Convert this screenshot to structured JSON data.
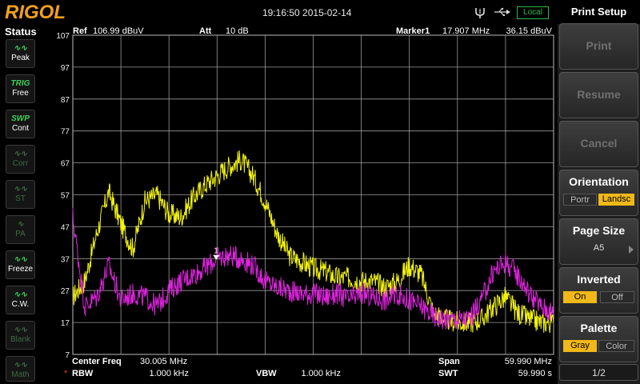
{
  "brand": "RIGOL",
  "datetime": "19:16:50 2015-02-14",
  "remote_status": "Local",
  "status_title": "Status",
  "status_items": [
    {
      "glyph": "∿∿",
      "label": "Peak",
      "active": true
    },
    {
      "glyph": "TRIG",
      "label": "Free",
      "active": true
    },
    {
      "glyph": "SWP",
      "label": "Cont",
      "active": true
    },
    {
      "glyph": "∿∿",
      "label": "Corr",
      "active": false
    },
    {
      "glyph": "∿∿",
      "label": "ST",
      "active": false
    },
    {
      "glyph": "∿",
      "label": "PA",
      "active": false
    },
    {
      "glyph": "∿∿",
      "label": "Freeze",
      "active": true
    },
    {
      "glyph": "∿∿",
      "label": "C.W.",
      "active": true
    },
    {
      "glyph": "∿∿",
      "label": "Blank",
      "active": false
    },
    {
      "glyph": "∿∿",
      "label": "Math",
      "active": false
    }
  ],
  "header": {
    "ref_label": "Ref",
    "ref_value": "106.99 dBuV",
    "att_label": "Att",
    "att_value": "10 dB",
    "marker_label": "Marker1",
    "marker_freq": "17.907 MHz",
    "marker_level": "36.15 dBuV"
  },
  "footer": {
    "center_label": "Center Freq",
    "center_value": "30.005 MHz",
    "span_label": "Span",
    "span_value": "59.990 MHz",
    "rbw_marker": "*",
    "rbw_label": "RBW",
    "rbw_value": "1.000 kHz",
    "vbw_label": "VBW",
    "vbw_value": "1.000 kHz",
    "swt_label": "SWT",
    "swt_value": "59.990 s"
  },
  "chart_data": {
    "type": "line",
    "y_ticks": [
      "107",
      "97",
      "87",
      "77",
      "67",
      "57",
      "47",
      "37",
      "27",
      "17",
      "7"
    ],
    "ylim": [
      7,
      107
    ],
    "xlim": [
      0.01,
      60.0
    ],
    "x_unit": "MHz",
    "grid": true,
    "marker": {
      "label": "1",
      "x": 17.907,
      "y": 36.15
    },
    "series": [
      {
        "color": "#f2f20a",
        "x": [
          0.01,
          1.5,
          3,
          4.5,
          6,
          7.5,
          9,
          10.5,
          12,
          13.5,
          15,
          16.5,
          18,
          19.5,
          21,
          22.5,
          24,
          25.5,
          27,
          28.5,
          30,
          31.5,
          33,
          34.5,
          36,
          37.5,
          39,
          40.5,
          42,
          43.5,
          45,
          46.5,
          48,
          49.5,
          51,
          52.5,
          54,
          55.5,
          57,
          58.5,
          60.0
        ],
        "y": [
          25,
          30,
          45,
          58,
          48,
          40,
          55,
          57,
          51,
          50,
          56,
          60,
          63,
          66,
          68,
          63,
          55,
          45,
          38,
          36,
          34,
          33,
          31,
          31,
          30,
          30,
          28,
          30,
          35,
          32,
          20,
          18,
          17,
          17,
          18,
          22,
          25,
          20,
          18,
          17,
          17
        ]
      },
      {
        "color": "#dd22dd",
        "x": [
          0.01,
          1.5,
          3,
          4.5,
          6,
          7.5,
          9,
          10.5,
          12,
          13.5,
          15,
          16.5,
          18,
          19.5,
          21,
          22.5,
          24,
          25.5,
          27,
          28.5,
          30,
          31.5,
          33,
          34.5,
          36,
          37.5,
          39,
          40.5,
          42,
          43.5,
          45,
          46.5,
          48,
          49.5,
          51,
          52.5,
          54,
          55.5,
          57,
          58.5,
          60.0
        ],
        "y": [
          50,
          22,
          25,
          35,
          24,
          26,
          25,
          22,
          27,
          30,
          32,
          34,
          37,
          38,
          37,
          35,
          30,
          28,
          27,
          26,
          26,
          25,
          26,
          24,
          26,
          25,
          24,
          26,
          24,
          22,
          19,
          18,
          18,
          18,
          24,
          33,
          36,
          32,
          26,
          22,
          20
        ]
      }
    ]
  },
  "panel": {
    "title": "Print Setup",
    "print": "Print",
    "resume": "Resume",
    "cancel": "Cancel",
    "orientation": {
      "title": "Orientation",
      "options": [
        "Portr",
        "Landsc"
      ],
      "selected": "Landsc"
    },
    "page_size": {
      "title": "Page Size",
      "value": "A5"
    },
    "inverted": {
      "title": "Inverted",
      "options": [
        "On",
        "Off"
      ],
      "selected": "On"
    },
    "palette": {
      "title": "Palette",
      "options": [
        "Gray",
        "Color"
      ],
      "selected": "Gray"
    },
    "page_indicator": "1/2"
  },
  "colors": {
    "accent": "#f0b818",
    "brand": "#f2a01d",
    "status_on": "#3cd25a",
    "trace1": "#f2f20a",
    "trace2": "#dd22dd"
  }
}
